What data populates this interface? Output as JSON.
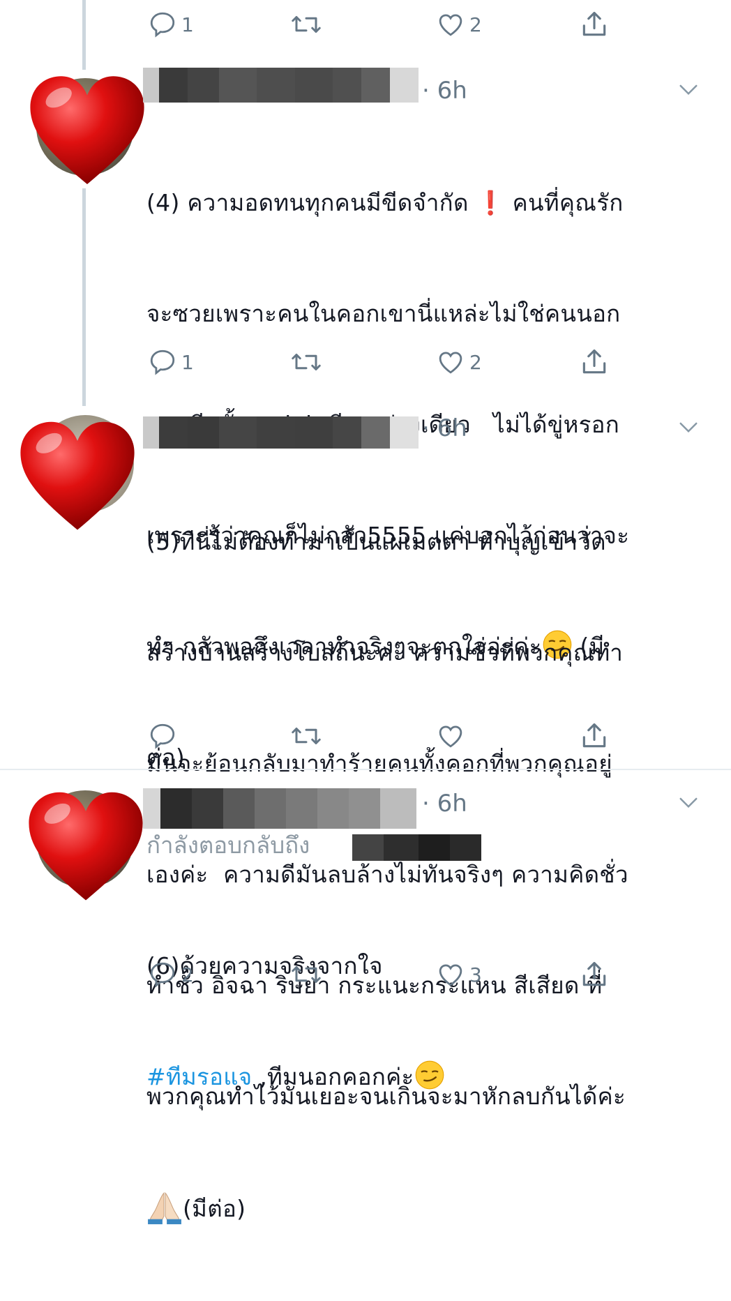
{
  "colors": {
    "accent": "#1b95e0",
    "text": "#141823",
    "muted": "#657786",
    "heart": "#d90d14",
    "thread_line": "#ccd6dd"
  },
  "top_actions": {
    "reply_count": "1",
    "like_count": "2"
  },
  "tweets": [
    {
      "time": "· 6h",
      "line1": "(4) ความอดทนทุกคนมีขีดจำกัด ",
      "line1_emoji": "❗",
      "line1_rest": " คนที่คุณรัก",
      "line2": "จะซวยเพราะคนในคอกเขานี่แหล่ะไม่ใช่คนนอก",
      "line3": "คอกอีกทั้งsocial เพียงอย่างเดียว   ไม่ได้ขู่หรอก",
      "line4": "เพราะรู้ว่าคุณก็ไม่กลัว5555 แค่บอกไว้ก่อนว่าจะ",
      "line5": "ทำ กลัวพอถึงเวลาทำจริงๆจะตกใจอ่ะค่ะ",
      "line5_tail": " (มี",
      "line6": "ต่อ)",
      "reply_count": "1",
      "like_count": "2",
      "icons": [
        "reply-icon",
        "retweet-icon",
        "like-icon",
        "share-icon"
      ]
    },
    {
      "time": "· 6h",
      "line1": "(5)ทีนี่ไม่ต้องทำมาเป็นแผ่เมตตา ทำบุญเข้าวัด",
      "line2": "สร้างบ้านสร้างโบสถ์นะคะ ความชั่วที่พวกคุณทำ",
      "line3": "มันจะย้อนกลับมาทำร้ายคนทั้งคอกที่พวกคุณอยู่",
      "line4": "เองค่ะ  ความดีมันลบล้างไม่ทันจริงๆ ความคิดชั่ว",
      "line5": "ทำชั่ว อิจฉา ริษยา กระแนะกระแหน สีเสียด ที่",
      "line6": "พวกคุณทำไว้มันเยอะจนเกินจะมาหักลบกันได้ค่ะ",
      "line7": "(มีต่อ)",
      "reply_count": "",
      "like_count": ""
    },
    {
      "time": "· 6h",
      "reply_to": "กำลังตอบกลับถึง",
      "line1": "(6)ด้วยความจริงจากใจ",
      "hashtag": "#ทีมรอแจ",
      "line2_rest": " ,ทีมนอกคอกค่ะ",
      "reply_count": "2",
      "like_count": "3"
    }
  ]
}
